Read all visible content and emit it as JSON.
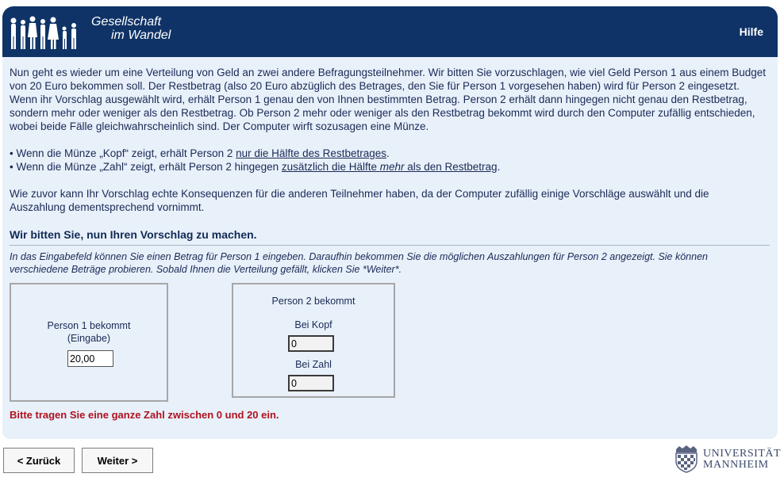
{
  "header": {
    "logo_line1": "Gesellschaft",
    "logo_line2": "im Wandel",
    "help_label": "Hilfe"
  },
  "intro": "Nun geht es wieder um eine Verteilung von Geld an zwei andere Befragungsteilnehmer. Wir bitten Sie vorzuschlagen, wie viel Geld Person 1 aus einem Budget von 20 Euro bekommen soll. Der Restbetrag (also 20 Euro abzüglich des Betrages, den Sie für Person 1 vorgesehen haben) wird für Person 2 eingesetzt. Wenn ihr Vorschlag ausgewählt wird, erhält Person 1 genau den von Ihnen bestimmten Betrag. Person 2 erhält dann hingegen nicht genau den Restbetrag, sondern mehr oder weniger als den Restbetrag. Ob Person 2 mehr oder weniger als den Restbetrag bekommt wird durch den Computer zufällig entschieden, wobei beide Fälle gleichwahrscheinlich sind. Der Computer wirft sozusagen eine Münze.",
  "bullets": {
    "kopf_pre": "• Wenn die Münze „Kopf“ zeigt, erhält Person 2 ",
    "kopf_u": "nur die Hälfte des Restbetrages",
    "kopf_post": ".",
    "zahl_pre": "• Wenn die Münze „Zahl“ zeigt, erhält Person 2 hingegen ",
    "zahl_u1": "zusätzlich die Hälfte ",
    "zahl_u2": "mehr",
    "zahl_u3": " als den Restbetrag",
    "zahl_post": "."
  },
  "consequence": "Wie zuvor kann Ihr Vorschlag echte Konsequenzen für die anderen Teilnehmer haben, da der Computer zufällig einige Vorschläge auswählt und die Auszahlung dementsprechend vornimmt.",
  "heading": "Wir bitten Sie, nun Ihren Vorschlag zu machen.",
  "hint": "In das Eingabefeld können Sie einen Betrag für Person 1 eingeben. Daraufhin bekommen Sie die möglichen Auszahlungen für Person 2 angezeigt. Sie können verschiedene Beträge probieren. Sobald Ihnen die Verteilung gefällt, klicken Sie *Weiter*.",
  "person1": {
    "label_line1": "Person 1 bekommt",
    "label_line2": "(Eingabe)",
    "value": "20,00"
  },
  "person2": {
    "title": "Person 2 bekommt",
    "kopf_label": "Bei Kopf",
    "kopf_value": "0",
    "zahl_label": "Bei Zahl",
    "zahl_value": "0"
  },
  "error": "Bitte tragen Sie eine ganze Zahl zwischen 0 und 20 ein.",
  "nav": {
    "back_label": "< Zurück",
    "next_label": "Weiter >"
  },
  "footer": {
    "uni_line1": "UNIVERSITÄT",
    "uni_line2": "MANNHEIM"
  }
}
